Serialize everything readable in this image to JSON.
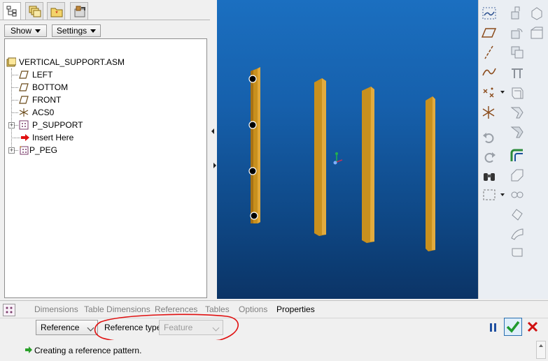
{
  "navigator": {
    "tabs": [
      "model-tree-icon",
      "layers-icon",
      "favorites-icon",
      "tools-icon"
    ],
    "show_label": "Show",
    "settings_label": "Settings",
    "tree": {
      "root": "VERTICAL_SUPPORT.ASM",
      "items": [
        {
          "label": "LEFT",
          "icon": "datum-plane-icon"
        },
        {
          "label": "BOTTOM",
          "icon": "datum-plane-icon"
        },
        {
          "label": "FRONT",
          "icon": "datum-plane-icon"
        },
        {
          "label": "ACS0",
          "icon": "coordinate-system-icon"
        },
        {
          "label": "P_SUPPORT",
          "icon": "part-icon"
        },
        {
          "label": "Insert Here",
          "icon": "insert-arrow-icon"
        },
        {
          "label": "P_PEG",
          "icon": "pattern-part-icon"
        }
      ]
    }
  },
  "viewport": {
    "background_top": "#1b6fc0",
    "background_bottom": "#0b3466",
    "part_color": "#c8901e",
    "pattern_marker_count": 4
  },
  "dashboard": {
    "tabs": [
      "Dimensions",
      "Table Dimensions",
      "References",
      "Tables",
      "Options",
      "Properties"
    ],
    "active_tab": "Properties",
    "pattern_type": "Reference",
    "reference_type_label": "Reference type",
    "reference_type_value": "Feature",
    "pause_icon": "pause-icon",
    "ok_icon": "checkmark-icon",
    "cancel_icon": "cancel-x-icon",
    "highlight_color": "#e01010"
  },
  "status": {
    "message": "Creating a reference pattern."
  }
}
